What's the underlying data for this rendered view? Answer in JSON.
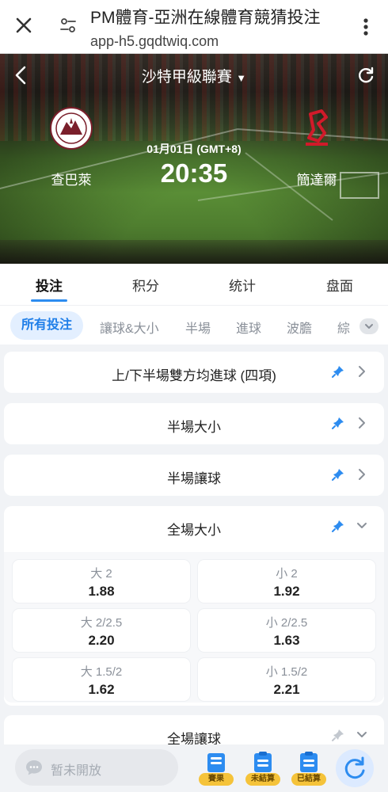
{
  "browser": {
    "title": "PM體育-亞洲在線體育競猜投注",
    "url": "app-h5.gqdtwiq.com"
  },
  "match": {
    "league": "沙特甲級聯賽",
    "home_team": "查巴萊",
    "away_team": "簡達爾",
    "date": "01月01日 (GMT+8)",
    "time": "20:35"
  },
  "main_tabs": [
    {
      "label": "投注",
      "active": true
    },
    {
      "label": "积分",
      "active": false
    },
    {
      "label": "统计",
      "active": false
    },
    {
      "label": "盘面",
      "active": false
    }
  ],
  "sub_tabs": [
    {
      "label": "所有投注",
      "active": true
    },
    {
      "label": "讓球&大小",
      "active": false
    },
    {
      "label": "半場",
      "active": false
    },
    {
      "label": "進球",
      "active": false
    },
    {
      "label": "波膽",
      "active": false
    },
    {
      "label": "綜",
      "active": false
    }
  ],
  "markets": [
    {
      "title": "上/下半場雙方均進球 (四項)",
      "expanded": false,
      "pinned": true
    },
    {
      "title": "半場大小",
      "expanded": false,
      "pinned": true
    },
    {
      "title": "半場讓球",
      "expanded": false,
      "pinned": true
    },
    {
      "title": "全場大小",
      "expanded": true,
      "pinned": true,
      "odds": [
        {
          "label": "大 2",
          "value": "1.88"
        },
        {
          "label": "小 2",
          "value": "1.92"
        },
        {
          "label": "大 2/2.5",
          "value": "2.20"
        },
        {
          "label": "小 2/2.5",
          "value": "1.63"
        },
        {
          "label": "大 1.5/2",
          "value": "1.62"
        },
        {
          "label": "小 1.5/2",
          "value": "2.21"
        }
      ]
    },
    {
      "title": "全場讓球",
      "expanded": false,
      "pinned": false
    }
  ],
  "bottom": {
    "chat_placeholder": "暂未開放",
    "tools": [
      {
        "badge": "賽果"
      },
      {
        "badge": "未結算"
      },
      {
        "badge": "已結算"
      }
    ]
  },
  "colors": {
    "accent": "#2d8cf0",
    "sub_tab_active_bg": "#e3efff",
    "badge": "#f5c33a"
  }
}
